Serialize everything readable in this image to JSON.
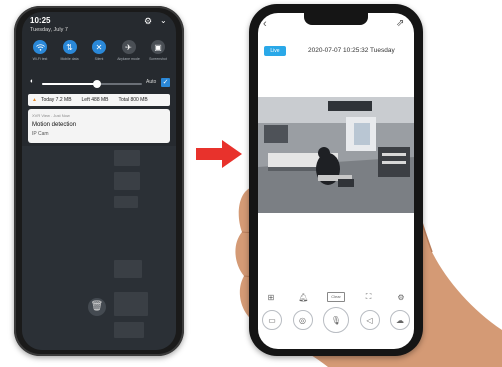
{
  "left_phone": {
    "status_time": "10:25",
    "status_date": "Tuesday, July 7",
    "quick_settings": [
      {
        "label": "Wi-Fi test",
        "icon": "wifi-icon",
        "on": true
      },
      {
        "label": "Mobile data",
        "icon": "mobile-data-icon",
        "on": true
      },
      {
        "label": "Silent",
        "icon": "silent-icon",
        "on": true
      },
      {
        "label": "Airplane mode",
        "icon": "airplane-icon",
        "on": false
      },
      {
        "label": "Screenshot",
        "icon": "screenshot-icon",
        "on": false
      }
    ],
    "brightness": {
      "level": 0.55,
      "auto_label": "Auto",
      "auto_checked": true
    },
    "data_usage": {
      "today": "Today 7.2 MB",
      "left": "Left 488 MB",
      "total": "Total 800 MB"
    },
    "notification": {
      "app": "XVR View . Just Now",
      "title": "Motion detection",
      "subtitle": "IP Cam"
    }
  },
  "right_phone": {
    "live_badge": "Live",
    "timestamp": "2020-07-07   10:25:32   Tuesday",
    "toolbar_top": [
      "grid-icon",
      "bell-icon",
      "clear-icon",
      "fullscreen-icon",
      "settings-icon"
    ],
    "clear_label": "Clear",
    "toolbar_bottom": [
      "record-icon",
      "snapshot-icon",
      "mic-icon",
      "speaker-icon",
      "cloud-icon"
    ]
  },
  "colors": {
    "accent_blue": "#2aa8e8",
    "arrow_red": "#e8322c"
  }
}
